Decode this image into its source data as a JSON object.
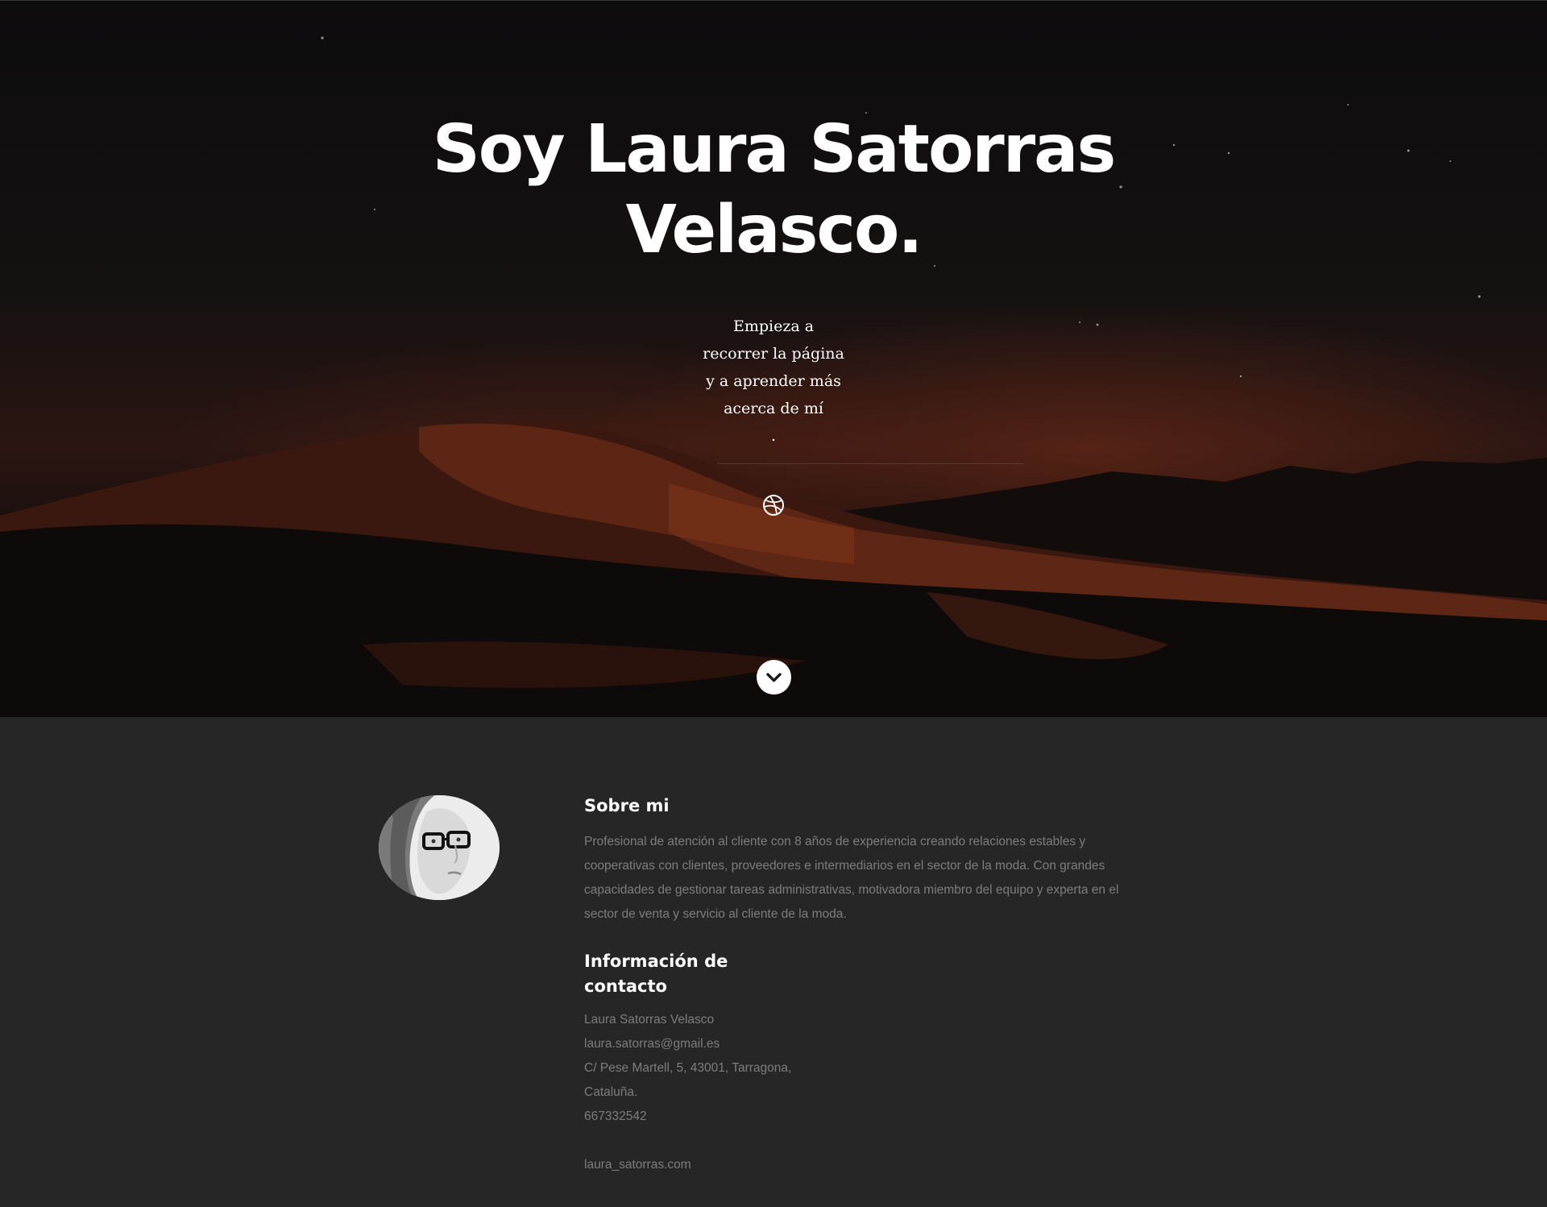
{
  "hero": {
    "title_line1": "Soy Laura Satorras",
    "title_line2": "Velasco.",
    "subtitle_lines": [
      "Empieza a",
      "recorrer la página",
      "y a aprender más",
      "acerca de mí",
      "."
    ],
    "social_icon": "dribbble-icon",
    "scroll_icon": "chevron-down-icon"
  },
  "about": {
    "heading": "Sobre mi",
    "text": "Profesional de atención al cliente con 8 años de experiencia creando relaciones estables y cooperativas con clientes, proveedores e intermediarios en el sector de la moda. Con grandes capacidades de gestionar tareas administrativas, motivadora miembro del equipo y experta en el sector de venta y servicio al cliente de la moda."
  },
  "contact": {
    "heading_line1": "Información de",
    "heading_line2": "contacto",
    "name": "Laura Satorras Velasco",
    "email": "laura.satorras@gmail.es",
    "address_line1": "C/ Pese Martell, 5, 43001, Tarragona,",
    "address_line2": "Cataluña.",
    "phone": "667332542",
    "website": "laura_satorras.com"
  },
  "colors": {
    "hero_bg": "#0b0a0b",
    "section_bg": "#262626",
    "text_muted": "#7d7d7d",
    "heading": "#ffffff"
  }
}
